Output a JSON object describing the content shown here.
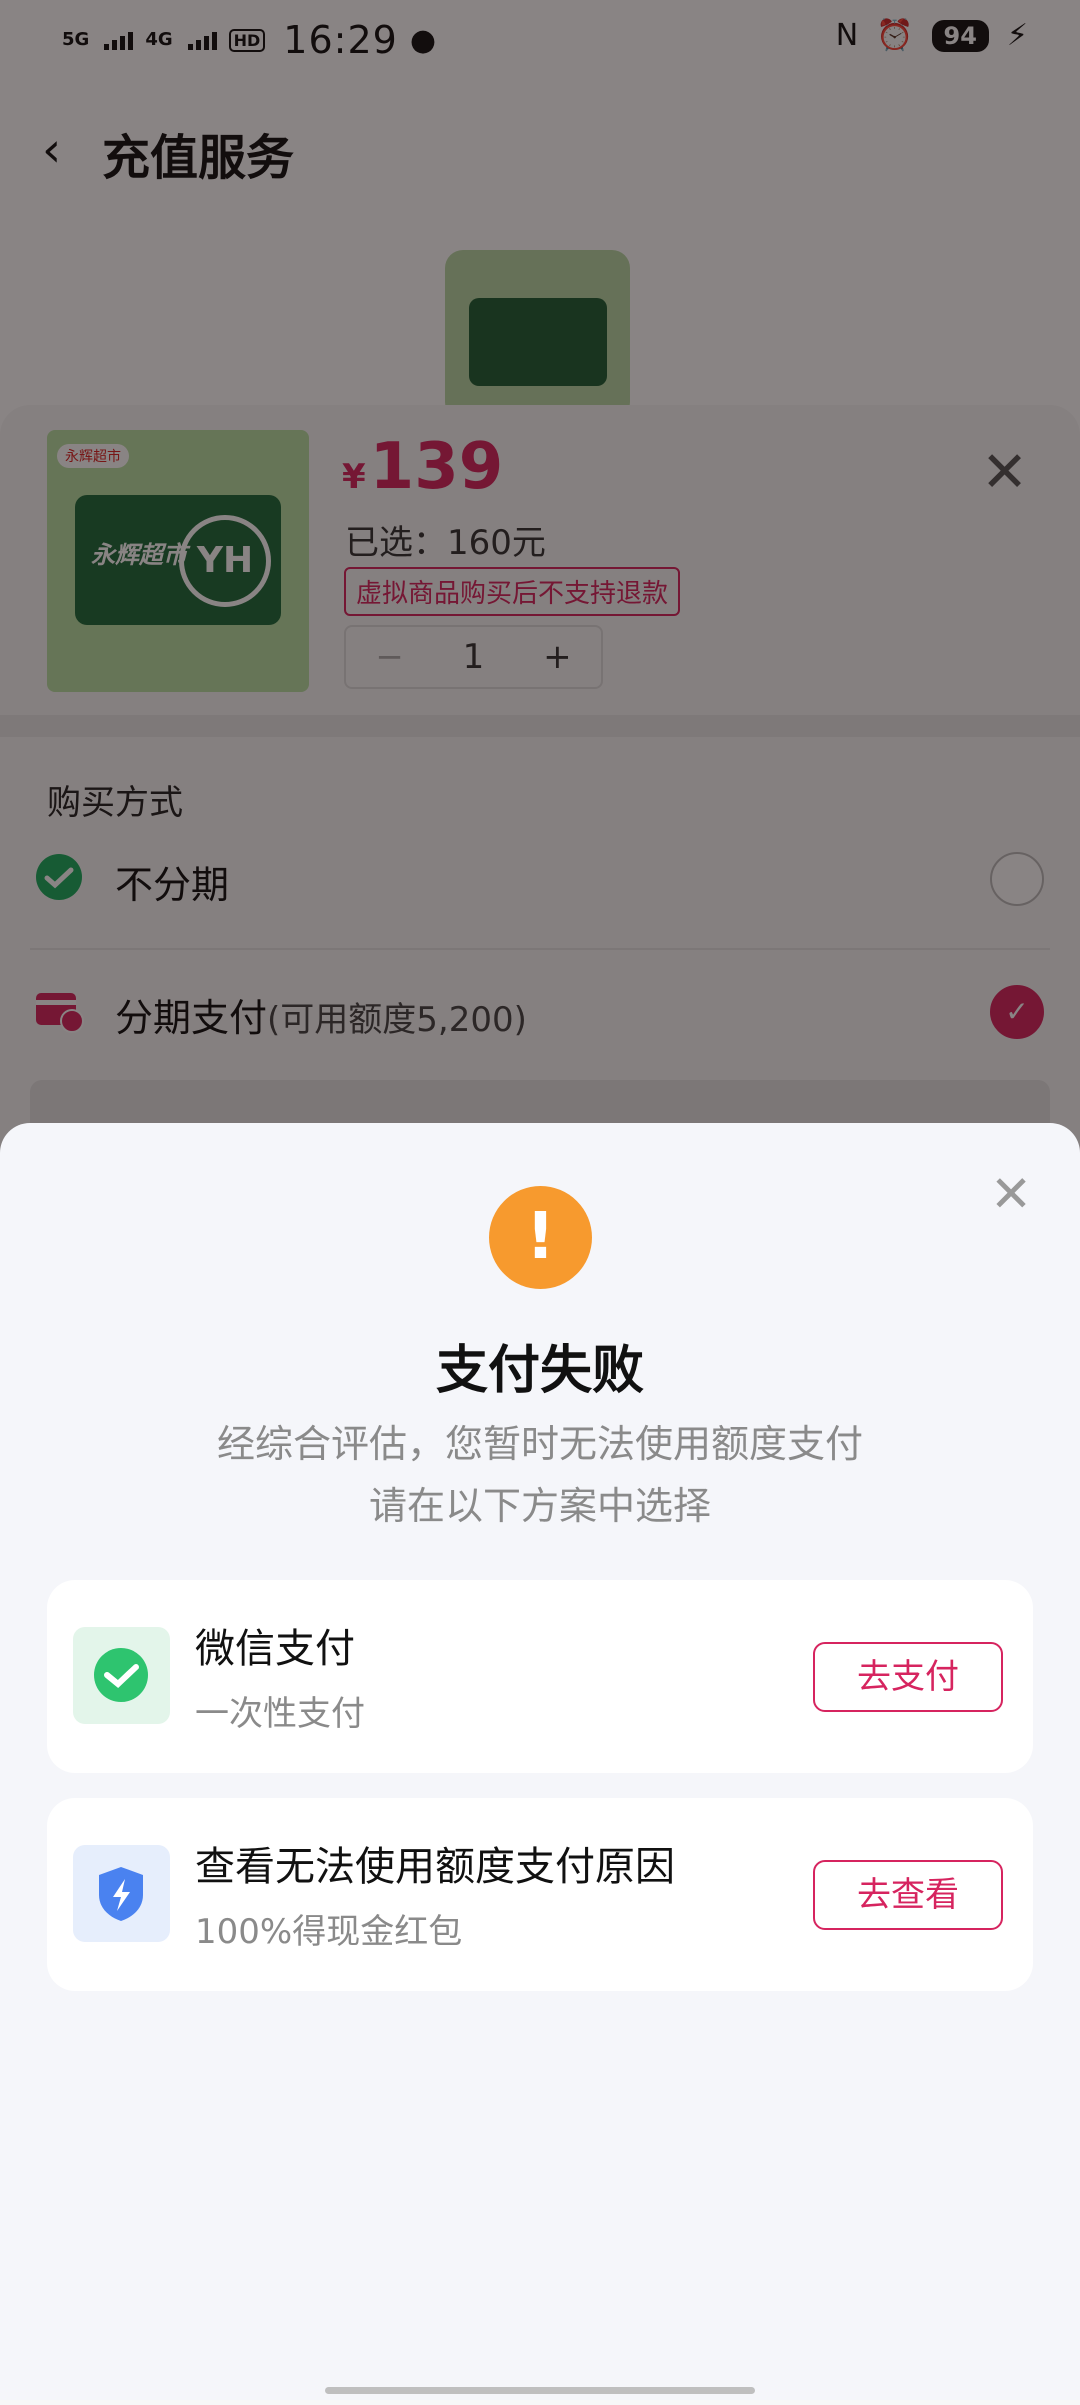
{
  "status_bar": {
    "signal1": "5G",
    "signal2": "4G",
    "hd": "HD",
    "time": "16:29",
    "nfc": "N",
    "alarm": "⏰",
    "battery": "94",
    "charging": "⚡"
  },
  "header": {
    "back": "‹",
    "title": "充值服务"
  },
  "product": {
    "brand_tag": "永辉超市",
    "card_text": "永辉超市",
    "card_logo": "YH",
    "currency": "¥",
    "price": "139",
    "selected": "已选：160元",
    "refund_notice": "虚拟商品购买后不支持退款",
    "qty_minus": "−",
    "qty": "1",
    "qty_plus": "+",
    "close": "✕"
  },
  "purchase": {
    "label": "购买方式",
    "option1": "不分期",
    "option2": "分期支付",
    "option2_note": "(可用额度5,200)",
    "check": "✓"
  },
  "modal": {
    "close": "✕",
    "warn": "!",
    "title": "支付失败",
    "desc_line1": "经综合评估，您暂时无法使用额度支付",
    "desc_line2": "请在以下方案中选择",
    "options": [
      {
        "title": "微信支付",
        "subtitle": "一次性支付",
        "button": "去支付",
        "icon": "wechat-pay-icon"
      },
      {
        "title": "查看无法使用额度支付原因",
        "subtitle": "100%得现金红包",
        "button": "去查看",
        "icon": "shield-lightning-icon"
      }
    ]
  },
  "colors": {
    "accent": "#d6245f",
    "warning": "#f79a2e",
    "wechat": "#1aad5e",
    "shield": "#4a82f0"
  }
}
